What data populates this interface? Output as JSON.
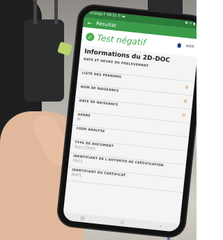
{
  "status_bar": {
    "left": "Orange F  08:31 ✆ ▬",
    "right": "✱ ᯤ ▮"
  },
  "app_bar": {
    "back": "←",
    "title": "Résultat"
  },
  "result": {
    "check": "✓",
    "title": "Test négatif",
    "help": "AIDE"
  },
  "section_title": "Informations du 2D-DOC",
  "fields": [
    {
      "label": "DATE ET HEURE DU PRELEVEMENT",
      "value": ""
    },
    {
      "label": "LISTE DES PRENOMS",
      "value": ""
    },
    {
      "label": "NOM DE NAISSANCE",
      "value": ""
    },
    {
      "label": "DATE DE NAISSANCE",
      "value": ""
    },
    {
      "label": "GENRE",
      "value": "M"
    },
    {
      "label": "CODE ANALYSE",
      "value": ""
    },
    {
      "label": "TYPE DE DOCUMENT",
      "value": "Test COVID"
    },
    {
      "label": "IDENTIFIANT DE L'AUTORITE DE CERTIFICATION",
      "value": "FR03"
    },
    {
      "label": "IDENTIFIANT DU CERTIFICAT",
      "value": "AHP1"
    }
  ],
  "nav": {
    "recent": "|||",
    "home": "○",
    "back": "‹"
  },
  "colors": {
    "status_green": "#2c7d3a",
    "appbar_green": "#3a9b49",
    "result_green": "#3fa84e"
  }
}
